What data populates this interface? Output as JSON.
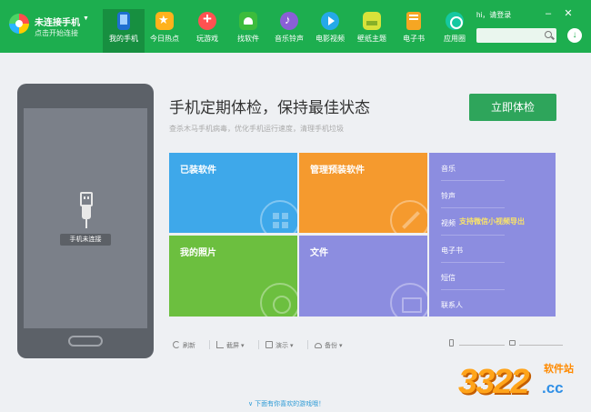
{
  "header": {
    "connection": {
      "title": "未连接手机",
      "subtitle": "点击开始连接"
    },
    "nav": [
      {
        "label": "我的手机",
        "icon": "phone-icon",
        "active": true
      },
      {
        "label": "今日热点",
        "icon": "star-icon"
      },
      {
        "label": "玩游戏",
        "icon": "gamepad-icon"
      },
      {
        "label": "找软件",
        "icon": "android-icon"
      },
      {
        "label": "音乐铃声",
        "icon": "music-icon"
      },
      {
        "label": "电影视频",
        "icon": "play-icon"
      },
      {
        "label": "壁纸主题",
        "icon": "wallpaper-icon"
      },
      {
        "label": "电子书",
        "icon": "book-icon"
      },
      {
        "label": "应用圈",
        "icon": "app-circle-icon"
      }
    ],
    "login": "hi，请登录",
    "window_controls": {
      "minimize": "–",
      "close": "✕"
    },
    "search_placeholder": "",
    "download_symbol": "↓"
  },
  "phone": {
    "status": "手机未连接"
  },
  "main": {
    "title": "手机定期体检，保持最佳状态",
    "subtitle": "查杀木马手机病毒，优化手机运行速度，清理手机垃圾",
    "check_button": "立即体检",
    "tiles": [
      {
        "label": "已装软件",
        "color": "#3ea8ea",
        "icon": "apps-grid-icon"
      },
      {
        "label": "管理预装软件",
        "color": "#f59a2e",
        "icon": "wrench-icon"
      },
      {
        "label": "我的照片",
        "color": "#6cbf3f",
        "icon": "photo-icon"
      },
      {
        "label": "文件",
        "color": "#8c8de0",
        "icon": "folder-icon"
      }
    ],
    "media": [
      "音乐",
      "铃声",
      "视频",
      "电子书",
      "短信",
      "联系人"
    ],
    "promo": "支持微信小视频导出",
    "tools": [
      {
        "label": "刷新",
        "icon": "refresh-icon"
      },
      {
        "label": "截屏 ▾",
        "icon": "crop-icon"
      },
      {
        "label": "演示 ▾",
        "icon": "present-icon"
      },
      {
        "label": "备份 ▾",
        "icon": "cloud-icon"
      }
    ],
    "bottom_link": "∨ 下面有你喜欢的游戏哦！"
  },
  "watermark": {
    "number": "3322",
    "site": "软件站",
    "domain": ".cc"
  }
}
